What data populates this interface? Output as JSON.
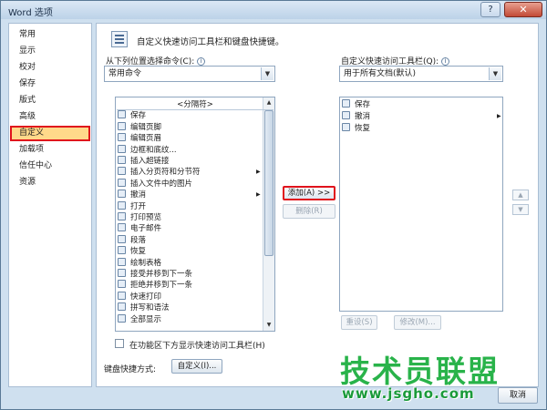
{
  "window": {
    "title": "Word 选项",
    "close_label": "✕",
    "help_label": "?"
  },
  "nav": {
    "items": [
      {
        "label": "常用",
        "active": false
      },
      {
        "label": "显示",
        "active": false
      },
      {
        "label": "校对",
        "active": false
      },
      {
        "label": "保存",
        "active": false
      },
      {
        "label": "版式",
        "active": false
      },
      {
        "label": "高级",
        "active": false
      },
      {
        "label": "自定义",
        "active": true
      },
      {
        "label": "加载项",
        "active": false
      },
      {
        "label": "信任中心",
        "active": false
      },
      {
        "label": "资源",
        "active": false
      }
    ]
  },
  "main": {
    "header": "自定义快速访问工具栏和键盘快捷键。",
    "choose_from_label": "从下列位置选择命令(C):",
    "choose_from_value": "常用命令",
    "customize_qat_label": "自定义快速访问工具栏(Q):",
    "customize_qat_value": "用于所有文档(默认)",
    "commands": [
      {
        "label": "<分隔符>",
        "separator": true
      },
      {
        "label": "保存",
        "icon": "save-icon"
      },
      {
        "label": "编辑页脚",
        "icon": "footer-icon"
      },
      {
        "label": "编辑页眉",
        "icon": "header-icon"
      },
      {
        "label": "边框和底纹...",
        "icon": "borders-icon"
      },
      {
        "label": "插入超链接",
        "icon": "hyperlink-icon"
      },
      {
        "label": "插入分页符和分节符",
        "icon": "page-break-icon",
        "submenu": true
      },
      {
        "label": "插入文件中的图片",
        "icon": "picture-icon"
      },
      {
        "label": "撤消",
        "icon": "undo-icon",
        "submenu": true
      },
      {
        "label": "打开",
        "icon": "open-icon"
      },
      {
        "label": "打印预览",
        "icon": "print-preview-icon"
      },
      {
        "label": "电子邮件",
        "icon": "email-icon"
      },
      {
        "label": "段落",
        "icon": "paragraph-icon"
      },
      {
        "label": "恢复",
        "icon": "redo-icon"
      },
      {
        "label": "绘制表格",
        "icon": "draw-table-icon"
      },
      {
        "label": "接受并移到下一条",
        "icon": "accept-icon"
      },
      {
        "label": "拒绝并移到下一条",
        "icon": "reject-icon"
      },
      {
        "label": "快速打印",
        "icon": "quick-print-icon"
      },
      {
        "label": "拼写和语法",
        "icon": "spelling-icon"
      },
      {
        "label": "全部显示",
        "icon": "show-all-icon"
      }
    ],
    "qat_items": [
      {
        "label": "保存",
        "icon": "save-icon"
      },
      {
        "label": "撤消",
        "icon": "undo-icon",
        "submenu": true
      },
      {
        "label": "恢复",
        "icon": "redo-icon"
      }
    ],
    "add_button": "添加(A) >>",
    "remove_button": "删除(R)",
    "reset_button": "重设(S)",
    "modify_button": "修改(M)...",
    "show_below_ribbon_label": "在功能区下方显示快速访问工具栏(H)",
    "keyboard_shortcuts_label": "键盘快捷方式:",
    "customize_button": "自定义(I)..."
  },
  "footer": {
    "cancel_button": "取消"
  },
  "watermark": {
    "main": "技术员联盟",
    "sub": "www.jsgho.com"
  }
}
